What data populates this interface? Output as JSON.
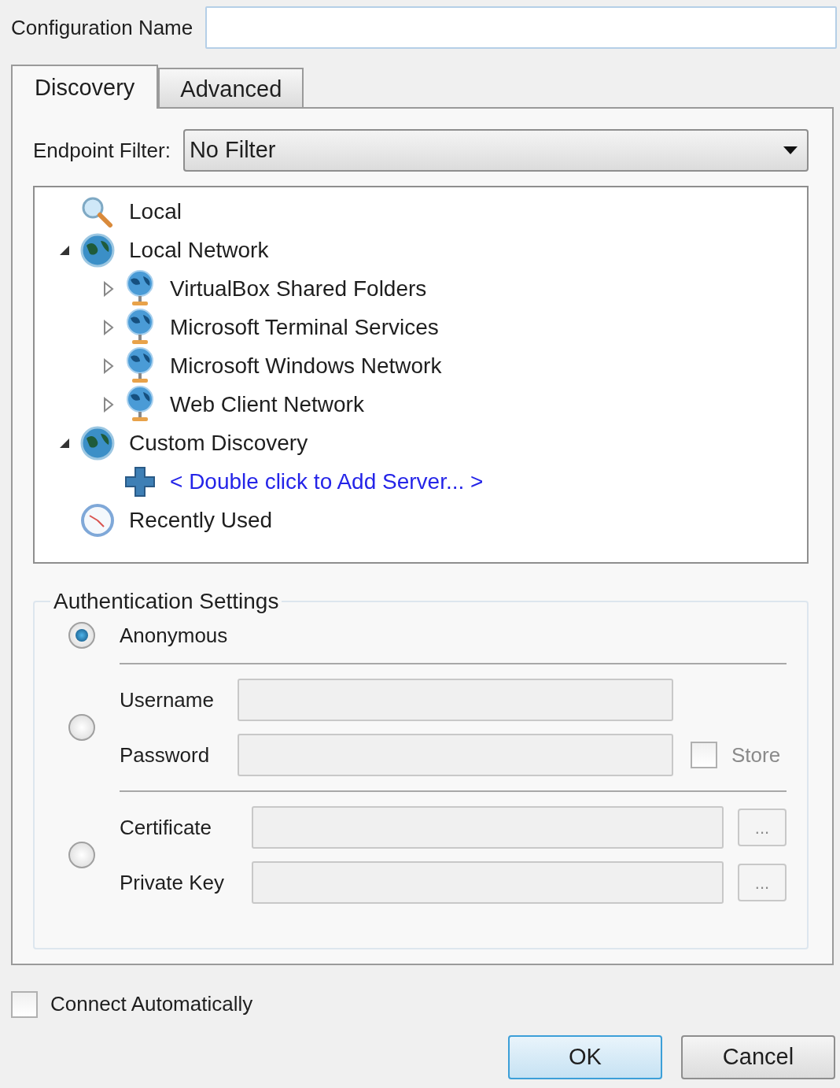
{
  "config_name": {
    "label": "Configuration Name"
  },
  "tabs": [
    {
      "label": "Discovery",
      "selected": true
    },
    {
      "label": "Advanced",
      "selected": false
    }
  ],
  "endpoint_filter": {
    "label": "Endpoint Filter:",
    "value": "No Filter"
  },
  "tree": [
    {
      "label": "Local",
      "kind": "search"
    },
    {
      "label": "Local Network",
      "kind": "globe",
      "expanded": true,
      "children": [
        {
          "label": "VirtualBox Shared Folders",
          "kind": "server",
          "expanded": false
        },
        {
          "label": "Microsoft Terminal Services",
          "kind": "server",
          "expanded": false
        },
        {
          "label": "Microsoft Windows Network",
          "kind": "server",
          "expanded": false
        },
        {
          "label": "Web Client Network",
          "kind": "server",
          "expanded": false
        }
      ]
    },
    {
      "label": "Custom Discovery",
      "kind": "globe",
      "expanded": true,
      "children": [
        {
          "label": "< Double click to Add Server... >",
          "kind": "add"
        }
      ]
    },
    {
      "label": "Recently Used",
      "kind": "clock"
    }
  ],
  "auth": {
    "title": "Authentication Settings",
    "options": [
      {
        "kind": "anonymous",
        "selected": true,
        "label": "Anonymous"
      },
      {
        "kind": "fields",
        "selected": false,
        "fields": [
          {
            "label": "Username",
            "disabled": true
          },
          {
            "label": "Password",
            "disabled": true,
            "store": {
              "label": "Store",
              "checked": false
            }
          }
        ]
      },
      {
        "kind": "fields",
        "selected": false,
        "fields": [
          {
            "label": "Certificate",
            "disabled": true,
            "browse": "..."
          },
          {
            "label": "Private Key",
            "disabled": true,
            "browse": "..."
          }
        ]
      }
    ]
  },
  "connect_automatically": {
    "label": "Connect Automatically",
    "checked": false
  },
  "buttons": [
    {
      "label": "OK",
      "default": true
    },
    {
      "label": "Cancel",
      "default": false
    }
  ]
}
